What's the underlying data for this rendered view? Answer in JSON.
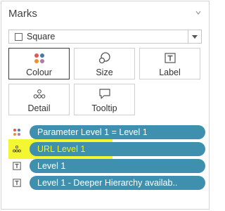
{
  "header": {
    "title": "Marks"
  },
  "mark_type": {
    "selected": "Square"
  },
  "buttons": [
    {
      "label": "Colour",
      "icon": "colour-dots-icon",
      "active": true
    },
    {
      "label": "Size",
      "icon": "size-circles-icon",
      "active": false
    },
    {
      "label": "Label",
      "icon": "label-T-icon",
      "active": false
    },
    {
      "label": "Detail",
      "icon": "detail-dots-icon",
      "active": false
    },
    {
      "label": "Tooltip",
      "icon": "tooltip-speech-icon",
      "active": false
    }
  ],
  "fields": [
    {
      "label": "Parameter Level 1 = Level 1",
      "icon": "colour-dots-icon"
    },
    {
      "label": "URL Level 1",
      "icon": "detail-dots-icon",
      "highlighted": true
    },
    {
      "label": "Level 1",
      "icon": "label-T-icon"
    },
    {
      "label": "Level 1 - Deeper Hierarchy availab..",
      "icon": "label-T-icon"
    }
  ],
  "colors": {
    "pill": "#3f8fae",
    "highlight": "#f1f50d",
    "active_border": "#3a3a3a"
  }
}
